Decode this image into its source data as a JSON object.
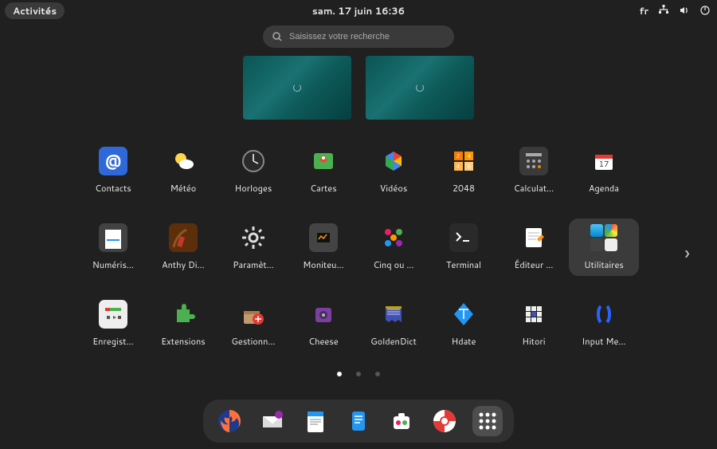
{
  "topbar": {
    "activities": "Activités",
    "datetime": "sam. 17 juin  16:36",
    "lang": "fr"
  },
  "search": {
    "placeholder": "Saisissez votre recherche"
  },
  "apps": [
    {
      "id": "contacts",
      "label": "Contacts"
    },
    {
      "id": "weather",
      "label": "Météo"
    },
    {
      "id": "clocks",
      "label": "Horloges"
    },
    {
      "id": "maps",
      "label": "Cartes"
    },
    {
      "id": "videos",
      "label": "Vidéos"
    },
    {
      "id": "2048",
      "label": "2048"
    },
    {
      "id": "calculator",
      "label": "Calculat…"
    },
    {
      "id": "agenda",
      "label": "Agenda"
    },
    {
      "id": "scan",
      "label": "Numéris…"
    },
    {
      "id": "anthy",
      "label": "Anthy Di…"
    },
    {
      "id": "settings",
      "label": "Paramèt…"
    },
    {
      "id": "monitor",
      "label": "Moniteu…"
    },
    {
      "id": "five",
      "label": "Cinq ou …"
    },
    {
      "id": "terminal",
      "label": "Terminal"
    },
    {
      "id": "editor",
      "label": "Éditeur …"
    },
    {
      "id": "utilities",
      "label": "Utilitaires",
      "selected": true,
      "folder": true
    },
    {
      "id": "record",
      "label": "Enregist…"
    },
    {
      "id": "extensions",
      "label": "Extensions"
    },
    {
      "id": "manager",
      "label": "Gestionn…"
    },
    {
      "id": "cheese",
      "label": "Cheese"
    },
    {
      "id": "goldendict",
      "label": "GoldenDict"
    },
    {
      "id": "hdate",
      "label": "Hdate"
    },
    {
      "id": "hitori",
      "label": "Hitori"
    },
    {
      "id": "inputmethod",
      "label": "Input Me…"
    }
  ],
  "pages": {
    "count": 3,
    "active": 0
  },
  "dash": [
    {
      "id": "firefox"
    },
    {
      "id": "mail"
    },
    {
      "id": "writer"
    },
    {
      "id": "notes"
    },
    {
      "id": "software"
    },
    {
      "id": "help"
    },
    {
      "id": "appgrid",
      "active": true
    }
  ]
}
